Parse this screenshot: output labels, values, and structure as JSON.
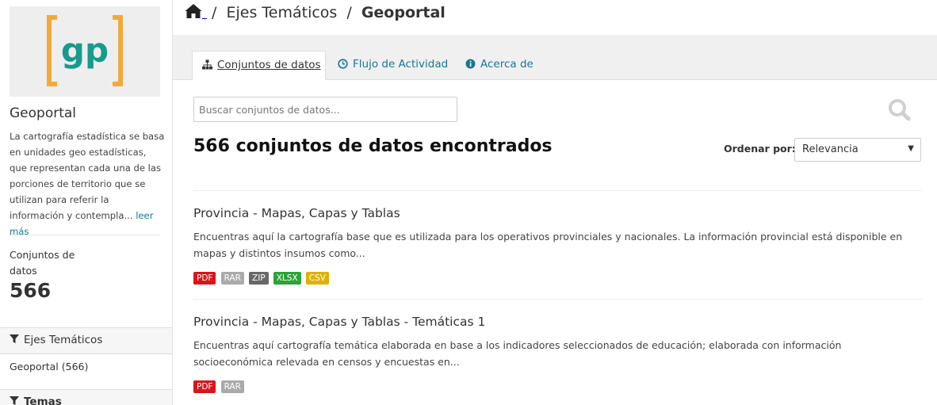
{
  "organization": {
    "logo_text": "gp",
    "logo_colors": {
      "bracket": "#f2a93b",
      "text": "#179b8e"
    },
    "name": "Geoportal",
    "description": "La cartografía estadística se basa en unidades geo estadísticas, que representan cada una de las porciones de territorio que se utilizan para referir la información y contempla...",
    "read_more": "leer más"
  },
  "stats": {
    "datasets_label": "Conjuntos de datos",
    "datasets_value": "566"
  },
  "facets": [
    {
      "title": "Ejes Temáticos",
      "items": [
        {
          "label": "Geoportal (566)"
        }
      ]
    },
    {
      "title": "Temas",
      "items": []
    }
  ],
  "breadcrumb": {
    "home_icon": "home-icon",
    "items": [
      "Ejes Temáticos",
      "Geoportal"
    ],
    "separator": "/"
  },
  "tabs": [
    {
      "label": "Conjuntos de datos",
      "icon": "sitemap-icon",
      "active": true
    },
    {
      "label": "Flujo de Actividad",
      "icon": "clock-icon",
      "active": false
    },
    {
      "label": "Acerca de",
      "icon": "info-icon",
      "active": false
    }
  ],
  "search": {
    "placeholder": "Buscar conjuntos de datos...",
    "value": ""
  },
  "results": {
    "count_text": "566 conjuntos de datos encontrados"
  },
  "order": {
    "label": "Ordenar por:",
    "selected": "Relevancia"
  },
  "datasets": [
    {
      "title": "Provincia - Mapas, Capas y Tablas",
      "notes": "Encuentras aquí la cartografía base que es utilizada para los operativos provinciales y nacionales. La información provincial está disponible en mapas y distintos insumos como...",
      "formats": [
        {
          "label": "PDF",
          "color": "#d9151b"
        },
        {
          "label": "RAR",
          "color": "#aaaaaa"
        },
        {
          "label": "ZIP",
          "color": "#686868"
        },
        {
          "label": "XLSX",
          "color": "#2ca437"
        },
        {
          "label": "CSV",
          "color": "#dfb100"
        }
      ]
    },
    {
      "title": "Provincia - Mapas, Capas y Tablas - Temáticas 1",
      "notes": "Encuentras aquí cartografía temática elaborada en base a los indicadores seleccionados de educación; elaborada con información socioeconómica relevada en censos y encuestas en...",
      "formats": [
        {
          "label": "PDF",
          "color": "#d9151b"
        },
        {
          "label": "RAR",
          "color": "#aaaaaa"
        }
      ]
    }
  ]
}
